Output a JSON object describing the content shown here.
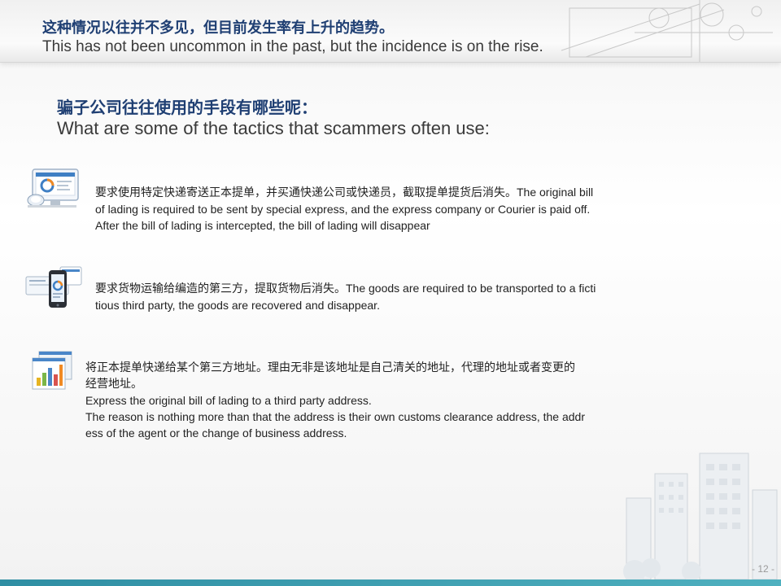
{
  "header": {
    "title_cn": "这种情况以往并不多见，但目前发生率有上升的趋势。",
    "title_en": "This has not been uncommon  in the past, but the incidence is on the rise."
  },
  "subheading": {
    "cn": "骗子公司往往使用的手段有哪些呢：",
    "en": "What are some of the tactics that scammers often use:"
  },
  "items": [
    {
      "icon": "monitor-chart-icon",
      "text_cn": "要求使用特定快递寄送正本提单，并买通快递公司或快递员，截取提单提货后消失。",
      "text_en_l1": "The original bill",
      "text_en_l2": "of lading is required to be sent by special express, and the express company or Courier is paid off.",
      "text_en_l3": "After the bill of lading is intercepted, the bill of lading will disappear"
    },
    {
      "icon": "phone-chart-icon",
      "text_cn": "要求货物运输给编造的第三方，提取货物后消失。",
      "text_en_l1": "The goods are required to be transported to a ficti",
      "text_en_l2": "tious third party, the goods are recovered and disappear."
    },
    {
      "icon": "bar-chart-icon",
      "text_cn_l1": "将正本提单快递给某个第三方地址。理由无非是该地址是自己清关的地址，代理的地址或者变更的",
      "text_cn_l2": "经营地址。",
      "text_en_l1": "Express the original bill of lading to a third party address.",
      "text_en_l2": "The reason is nothing  more than that the address is their own customs clearance address, the addr",
      "text_en_l3": "ess of the agent or the change of business address."
    }
  ],
  "footer": {
    "page_number": "- 12 -"
  },
  "colors": {
    "heading_blue": "#1f3f73",
    "footer_teal": "#2f8ea3"
  }
}
